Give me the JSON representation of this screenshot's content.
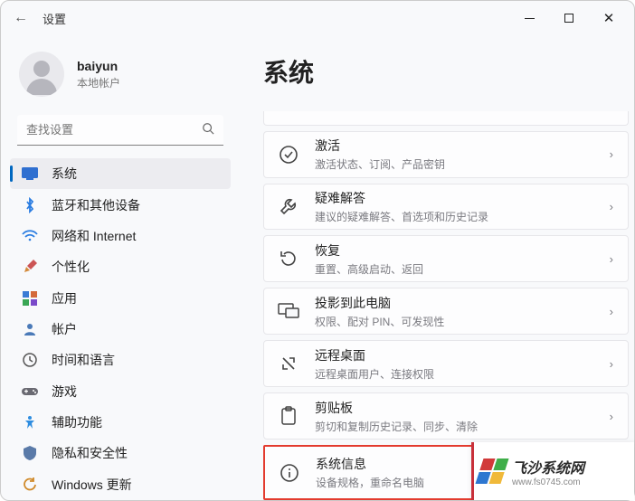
{
  "titlebar": {
    "title": "设置"
  },
  "user": {
    "name": "baiyun",
    "sub": "本地帐户"
  },
  "search": {
    "placeholder": "查找设置"
  },
  "nav": [
    {
      "key": "system",
      "label": "系统"
    },
    {
      "key": "bluetooth",
      "label": "蓝牙和其他设备"
    },
    {
      "key": "network",
      "label": "网络和 Internet"
    },
    {
      "key": "personalization",
      "label": "个性化"
    },
    {
      "key": "apps",
      "label": "应用"
    },
    {
      "key": "accounts",
      "label": "帐户"
    },
    {
      "key": "time",
      "label": "时间和语言"
    },
    {
      "key": "gaming",
      "label": "游戏"
    },
    {
      "key": "accessibility",
      "label": "辅助功能"
    },
    {
      "key": "privacy",
      "label": "隐私和安全性"
    },
    {
      "key": "update",
      "label": "Windows 更新"
    }
  ],
  "page": {
    "title": "系统"
  },
  "cards": [
    {
      "key": "activation",
      "title": "激活",
      "sub": "激活状态、订阅、产品密钥"
    },
    {
      "key": "troubleshoot",
      "title": "疑难解答",
      "sub": "建议的疑难解答、首选项和历史记录"
    },
    {
      "key": "recovery",
      "title": "恢复",
      "sub": "重置、高级启动、返回"
    },
    {
      "key": "project",
      "title": "投影到此电脑",
      "sub": "权限、配对 PIN、可发现性"
    },
    {
      "key": "remote",
      "title": "远程桌面",
      "sub": "远程桌面用户、连接权限"
    },
    {
      "key": "clipboard",
      "title": "剪贴板",
      "sub": "剪切和复制历史记录、同步、清除"
    },
    {
      "key": "about",
      "title": "系统信息",
      "sub": "设备规格，重命名电脑"
    }
  ],
  "watermark": {
    "title": "飞沙系统网",
    "url": "www.fs0745.com"
  }
}
